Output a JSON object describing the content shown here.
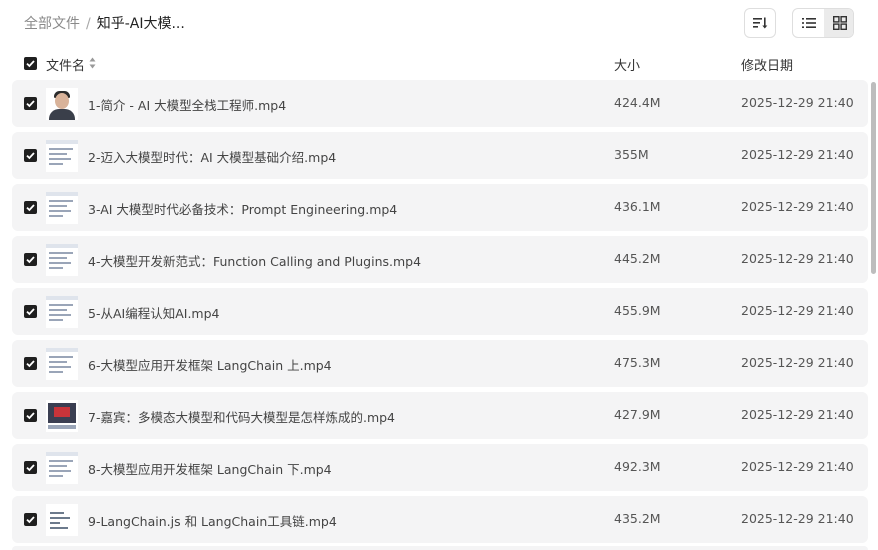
{
  "breadcrumb": {
    "root": "全部文件",
    "separator": "/",
    "current": "知乎-AI大模..."
  },
  "toolbar": {
    "sort_icon": "sort-icon",
    "list_view_icon": "list-view-icon",
    "grid_view_icon": "grid-view-icon"
  },
  "columns": {
    "name": "文件名",
    "size": "大小",
    "date": "修改日期"
  },
  "files": [
    {
      "name": "1-简介 - AI 大模型全栈工程师.mp4",
      "size": "424.4M",
      "date": "2025-12-29 21:40",
      "thumb": "person"
    },
    {
      "name": "2-迈入大模型时代：AI 大模型基础介绍.mp4",
      "size": "355M",
      "date": "2025-12-29 21:40",
      "thumb": "slide"
    },
    {
      "name": "3-AI 大模型时代必备技术：Prompt Engineering.mp4",
      "size": "436.1M",
      "date": "2025-12-29 21:40",
      "thumb": "slide"
    },
    {
      "name": "4-大模型开发新范式：Function Calling and Plugins.mp4",
      "size": "445.2M",
      "date": "2025-12-29 21:40",
      "thumb": "slide"
    },
    {
      "name": "5-从AI编程认知AI.mp4",
      "size": "455.9M",
      "date": "2025-12-29 21:40",
      "thumb": "slide"
    },
    {
      "name": "6-大模型应用开发框架 LangChain 上.mp4",
      "size": "475.3M",
      "date": "2025-12-29 21:40",
      "thumb": "slide"
    },
    {
      "name": "7-嘉宾：多模态大模型和代码大模型是怎样炼成的.mp4",
      "size": "427.9M",
      "date": "2025-12-29 21:40",
      "thumb": "red"
    },
    {
      "name": "8-大模型应用开发框架 LangChain 下.mp4",
      "size": "492.3M",
      "date": "2025-12-29 21:40",
      "thumb": "slide"
    },
    {
      "name": "9-LangChain.js 和 LangChain工具链.mp4",
      "size": "435.2M",
      "date": "2025-12-29 21:40",
      "thumb": "dark"
    }
  ]
}
